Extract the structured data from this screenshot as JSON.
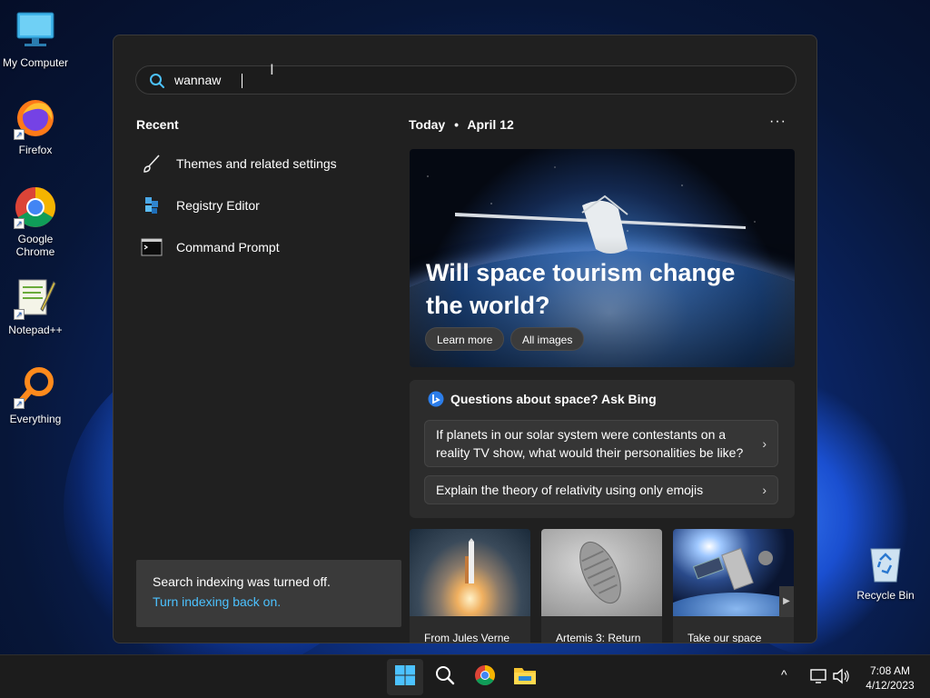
{
  "desktop": {
    "icons": [
      {
        "label": "My Computer"
      },
      {
        "label": "Firefox"
      },
      {
        "label": "Google\nChrome",
        "line1": "Google",
        "line2": "Chrome"
      },
      {
        "label": "Notepad++"
      },
      {
        "label": "Everything"
      }
    ],
    "recycle_bin": "Recycle Bin"
  },
  "search": {
    "value": "wannaw",
    "icon": "search-icon"
  },
  "recent": {
    "title": "Recent",
    "items": [
      {
        "label": "Themes and related settings",
        "icon": "brush-icon"
      },
      {
        "label": "Registry Editor",
        "icon": "registry-editor-icon"
      },
      {
        "label": "Command Prompt",
        "icon": "command-prompt-icon"
      }
    ]
  },
  "indexing": {
    "message": "Search indexing was turned off.",
    "link": "Turn indexing back on."
  },
  "today": {
    "label": "Today",
    "separator": "•",
    "date": "April 12",
    "more": "···"
  },
  "hero": {
    "title": "Will space tourism change the world?",
    "buttons": [
      "Learn more",
      "All images"
    ]
  },
  "bing": {
    "title": "Questions about space? Ask Bing",
    "questions": [
      "If planets in our solar system were contestants on a reality TV show, what would their personalities be like?",
      "Explain the theory of relativity using only emojis"
    ]
  },
  "news": [
    {
      "caption": "From Jules Verne"
    },
    {
      "caption": "Artemis 3: Return"
    },
    {
      "caption": "Take our space"
    }
  ],
  "taskbar": {
    "time": "7:08 AM",
    "date": "4/12/2023"
  },
  "colors": {
    "accent": "#4cc2ff",
    "panel": "#202020",
    "card": "#2c2c2c"
  }
}
